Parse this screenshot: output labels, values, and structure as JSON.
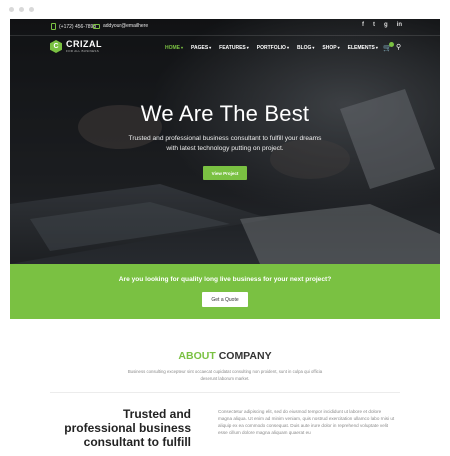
{
  "header": {
    "phone": "(+172) 456-7898",
    "email": "addyour@emailhere",
    "social": [
      "f",
      "t",
      "g",
      "in"
    ]
  },
  "brand": {
    "name": "CRIZAL",
    "tagline": "FOR ALL BUSINESS"
  },
  "nav": {
    "items": [
      {
        "label": "HOME"
      },
      {
        "label": "PAGES"
      },
      {
        "label": "FEATURES"
      },
      {
        "label": "PORTFOLIO"
      },
      {
        "label": "BLOG"
      },
      {
        "label": "SHOP"
      },
      {
        "label": "ELEMENTS"
      }
    ],
    "active_index": 0
  },
  "hero": {
    "title": "We Are The Best",
    "subtitle": "Trusted and professional business consultant to fulfill your dreams with latest technology putting on project.",
    "button": "View Project"
  },
  "cta": {
    "text": "Are you looking for quality long live business for your next project?",
    "button": "Get a Quote"
  },
  "about": {
    "title_accent": "ABOUT",
    "title_rest": "COMPANY",
    "description": "Business consulting excepteur sint occaecat cupidatat consulting non proident, sunt in culpa qui officia deserunt laborum market.",
    "heading": "Trusted and professional business consultant to fulfill",
    "body": "Consectetur adipiscing elit, sed do eiusmod tempor incididunt ut labore et dolore magna aliqua. Ut enim ad minim veniam, quis nostrud exercitation ullamco labo rnisi ut aliquip ex ea commodo consequat. Duis aute irure dolor in reprehend voluptate velit esse cillum dolore magna aliquam quaerat eu"
  },
  "colors": {
    "accent": "#7ac142",
    "hero_dark": "#1b1d20"
  }
}
